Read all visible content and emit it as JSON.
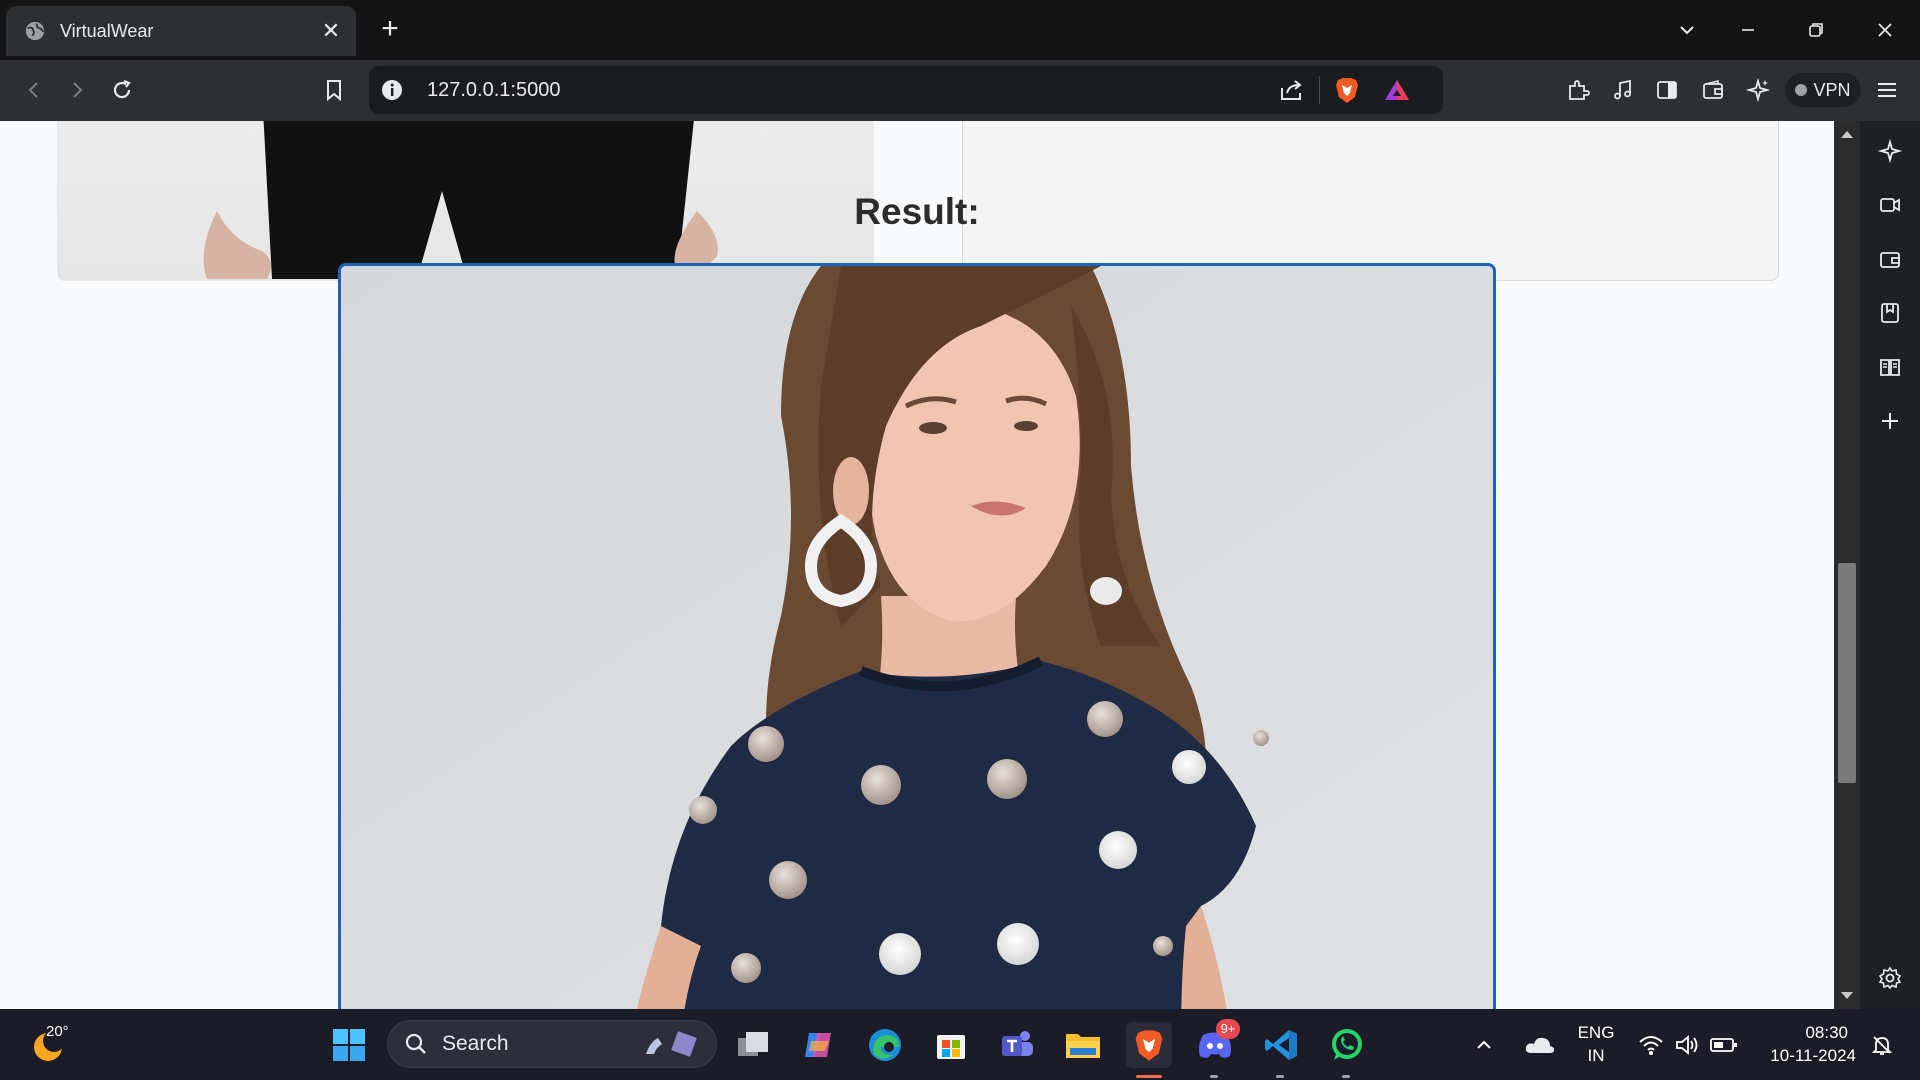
{
  "browser": {
    "tab": {
      "title": "VirtualWear",
      "close": "✕"
    },
    "new_tab": "+",
    "url": "127.0.0.1:5000",
    "vpn_label": "VPN"
  },
  "page": {
    "result_heading": "Result:"
  },
  "taskbar": {
    "weather_temp": "20°",
    "search_label": "Search",
    "lang_line1": "ENG",
    "lang_line2": "IN",
    "time": "08:30",
    "date": "10-11-2024",
    "discord_badge": "9+"
  }
}
